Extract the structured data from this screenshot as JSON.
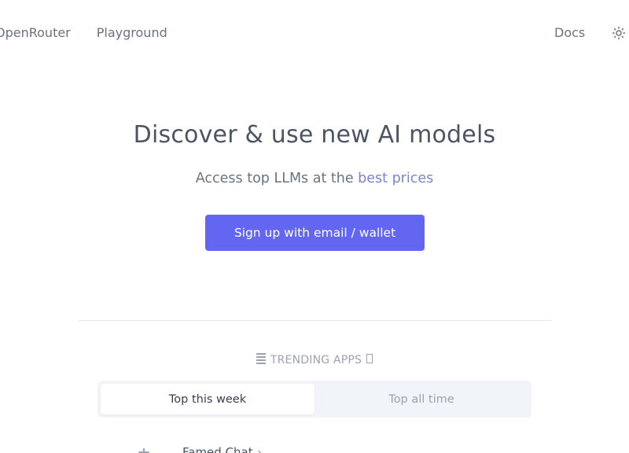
{
  "nav": {
    "brand": "OpenRouter",
    "playground": "Playground",
    "docs": "Docs",
    "theme_icon": "sun-icon"
  },
  "hero": {
    "title": "Discover & use new AI models",
    "subtitle_prefix": "Access top LLMs at the ",
    "subtitle_accent": "best prices",
    "cta": "Sign up with email / wallet"
  },
  "trending": {
    "label": "TRENDING APPS",
    "tabs": [
      {
        "label": "Top this week",
        "active": true
      },
      {
        "label": "Top all time",
        "active": false
      }
    ],
    "apps": [
      {
        "name": "Famed Chat",
        "icon": "robot-icon"
      }
    ]
  },
  "colors": {
    "accent": "#6366f1",
    "accent_text": "#7c83d6",
    "muted": "#6b7280"
  }
}
